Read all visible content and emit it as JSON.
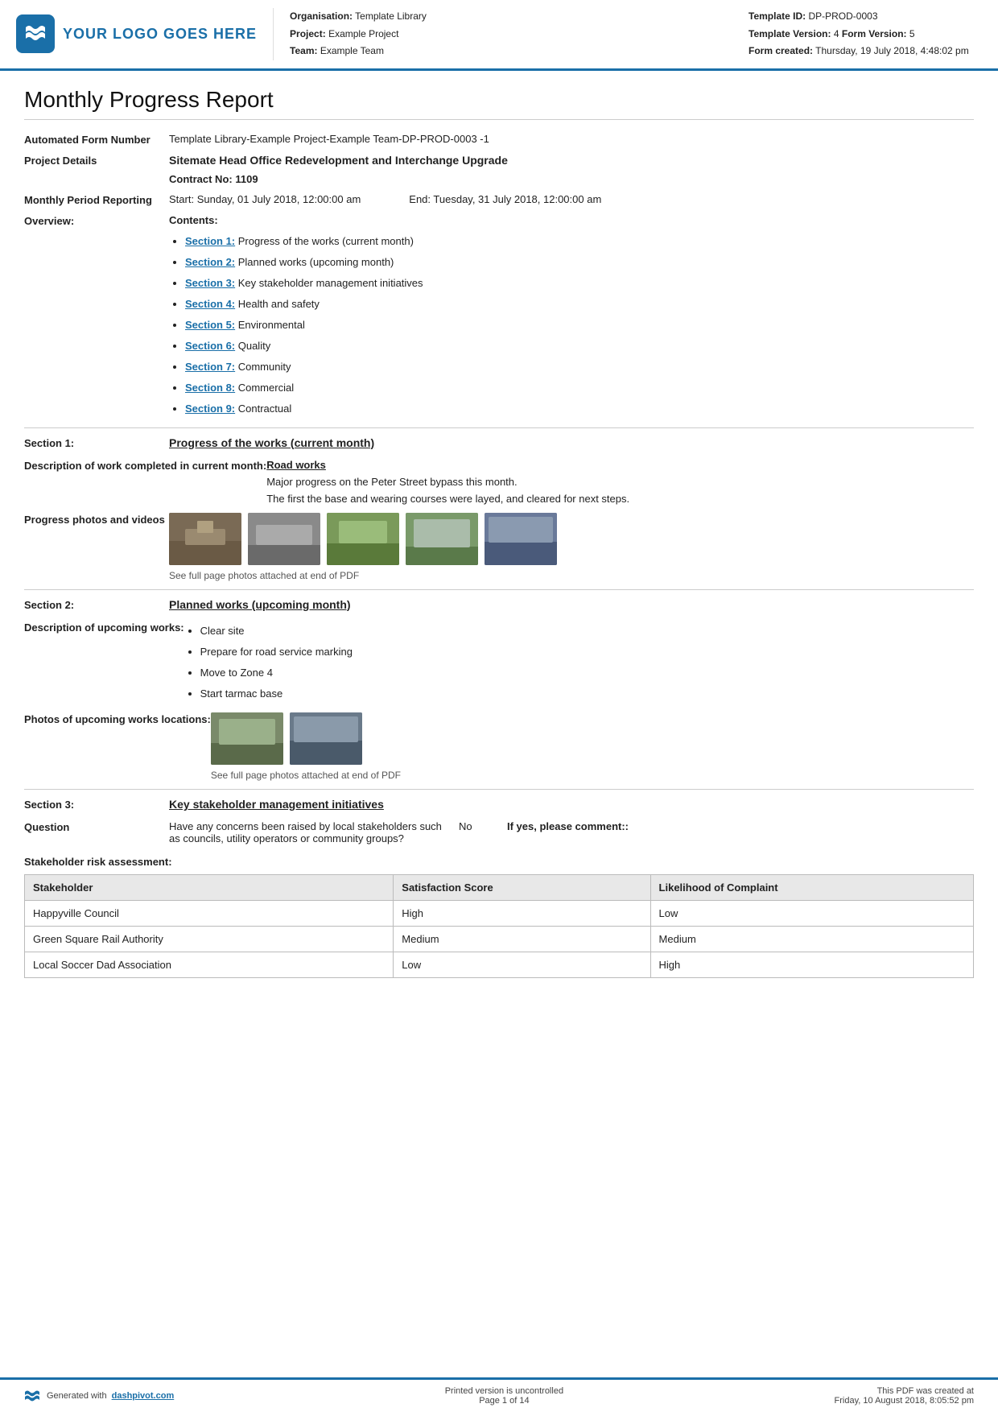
{
  "header": {
    "logo_text": "YOUR LOGO GOES HERE",
    "org_label": "Organisation:",
    "org_value": "Template Library",
    "project_label": "Project:",
    "project_value": "Example Project",
    "team_label": "Team:",
    "team_value": "Example Team",
    "template_id_label": "Template ID:",
    "template_id_value": "DP-PROD-0003",
    "template_version_label": "Template Version:",
    "template_version_value": "4",
    "form_version_label": "Form Version:",
    "form_version_value": "5",
    "form_created_label": "Form created:",
    "form_created_value": "Thursday, 19 July 2018, 4:48:02 pm"
  },
  "report": {
    "title": "Monthly Progress Report",
    "automated_form_label": "Automated Form Number",
    "automated_form_value": "Template Library-Example Project-Example Team-DP-PROD-0003   -1",
    "project_details_label": "Project Details",
    "project_details_value": "Sitemate Head Office Redevelopment and Interchange Upgrade",
    "contract_label": "Contract No:",
    "contract_value": "1109",
    "monthly_period_label": "Monthly Period Reporting",
    "period_start_label": "Start:",
    "period_start_value": "Sunday, 01 July 2018, 12:00:00 am",
    "period_end_label": "End:",
    "period_end_value": "Tuesday, 31 July 2018, 12:00:00 am",
    "overview_label": "Overview:",
    "contents_label": "Contents:",
    "contents_items": [
      {
        "link": "Section 1:",
        "text": " Progress of the works (current month)"
      },
      {
        "link": "Section 2:",
        "text": " Planned works (upcoming month)"
      },
      {
        "link": "Section 3:",
        "text": " Key stakeholder management initiatives"
      },
      {
        "link": "Section 4:",
        "text": " Health and safety"
      },
      {
        "link": "Section 5:",
        "text": " Environmental"
      },
      {
        "link": "Section 6:",
        "text": " Quality"
      },
      {
        "link": "Section 7:",
        "text": " Community"
      },
      {
        "link": "Section 8:",
        "text": " Commercial"
      },
      {
        "link": "Section 9:",
        "text": " Contractual"
      }
    ],
    "section1_label": "Section 1:",
    "section1_title": "Progress of the works (current month)",
    "desc_work_label": "Description of work completed in current month:",
    "desc_work_subtitle": "Road works",
    "desc_work_text1": "Major progress on the Peter Street bypass this month.",
    "desc_work_text2": "The first the base and wearing courses were layed, and cleared for next steps.",
    "progress_photos_label": "Progress photos and videos",
    "photos_caption": "See full page photos attached at end of PDF",
    "section2_label": "Section 2:",
    "section2_title": "Planned works (upcoming month)",
    "upcoming_works_label": "Description of upcoming works:",
    "upcoming_works_items": [
      "Clear site",
      "Prepare for road service marking",
      "Move to Zone 4",
      "Start tarmac base"
    ],
    "upcoming_photos_label": "Photos of upcoming works locations:",
    "upcoming_photos_caption": "See full page photos attached at end of PDF",
    "section3_label": "Section 3:",
    "section3_title": "Key stakeholder management initiatives",
    "question_label": "Question",
    "question_text": "Have any concerns been raised by local stakeholders such as councils, utility operators or community groups?",
    "question_answer": "No",
    "question_comment_label": "If yes, please comment::",
    "stakeholder_table_title": "Stakeholder risk assessment:",
    "table_headers": [
      "Stakeholder",
      "Satisfaction Score",
      "Likelihood of Complaint"
    ],
    "table_rows": [
      [
        "Happyville Council",
        "High",
        "Low"
      ],
      [
        "Green Square Rail Authority",
        "Medium",
        "Medium"
      ],
      [
        "Local Soccer Dad Association",
        "Low",
        "High"
      ]
    ]
  },
  "footer": {
    "generated_text": "Generated with",
    "brand_link": "dashpivot.com",
    "printed_text": "Printed version is uncontrolled",
    "page_text": "Page 1 of 14",
    "pdf_created_text": "This PDF was created at",
    "pdf_created_date": "Friday, 10 August 2018, 8:05:52 pm"
  }
}
